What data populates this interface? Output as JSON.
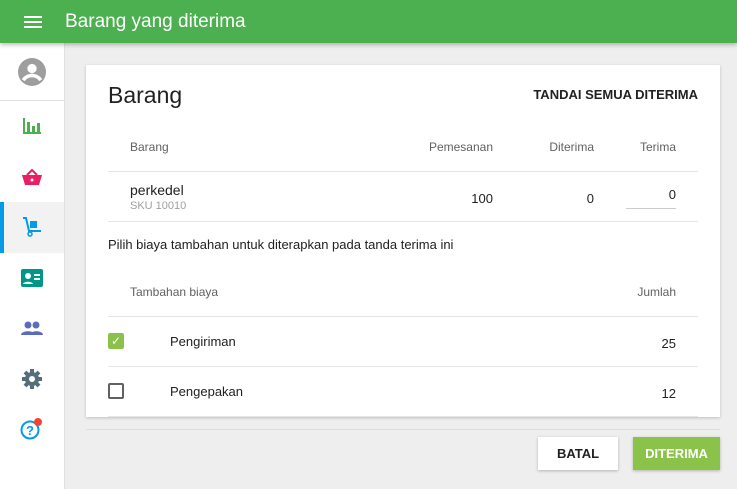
{
  "header": {
    "title": "Barang yang diterima"
  },
  "sidebar": {
    "items": [
      "chart",
      "basket",
      "cart",
      "id-card",
      "people",
      "settings",
      "help"
    ]
  },
  "card": {
    "title": "Barang",
    "mark_all": "TANDAI SEMUA DITERIMA",
    "columns": [
      "Barang",
      "Pemesanan",
      "Diterima",
      "Terima"
    ],
    "items": [
      {
        "name": "perkedel",
        "sku": "SKU 10010",
        "ordered": "100",
        "received": "0",
        "accept": "0"
      }
    ],
    "fees_prompt": "Pilih biaya tambahan untuk diterapkan pada tanda terima ini",
    "fee_columns": [
      "Tambahan biaya",
      "Jumlah"
    ],
    "fees": [
      {
        "name": "Pengiriman",
        "amount": "25",
        "checked": true
      },
      {
        "name": "Pengepakan",
        "amount": "12",
        "checked": false
      }
    ]
  },
  "actions": {
    "cancel": "BATAL",
    "confirm": "DITERIMA"
  },
  "colors": {
    "primary": "#4caf50",
    "confirm": "#8bc34a",
    "active": "#039be5"
  }
}
